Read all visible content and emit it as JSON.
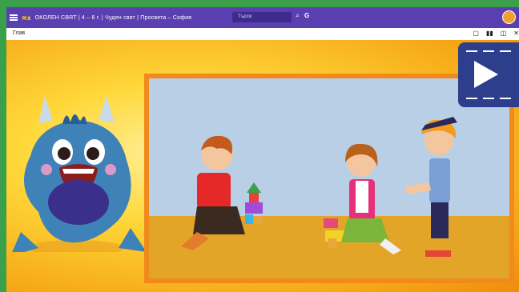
{
  "header": {
    "logo_text": "ⴷⴱⵛ",
    "title": "ОКОЛЕН СВЯТ | 4 – 6 г. | Чуден свят | Просвета – София",
    "search_placeholder": "Търси"
  },
  "toolbar": {
    "breadcrumb": "Глав"
  },
  "colors": {
    "topbar": "#5a3fb0",
    "frame_green": "#3aa04a",
    "video_border": "#f08a1c",
    "play_button": "#2c3e8c"
  },
  "icons": [
    "menu-icon",
    "search-icon",
    "google-icon",
    "bookmark-icon",
    "columns-icon",
    "window-icon",
    "close-icon",
    "play-icon"
  ]
}
